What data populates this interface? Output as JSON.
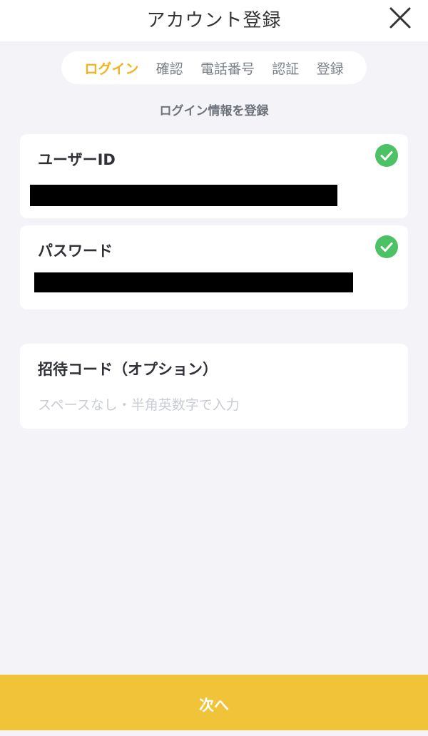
{
  "header": {
    "title": "アカウント登録",
    "close_icon": "close-icon"
  },
  "stepper": {
    "steps": [
      {
        "label": "ログイン",
        "active": true
      },
      {
        "label": "確認",
        "active": false
      },
      {
        "label": "電話番号",
        "active": false
      },
      {
        "label": "認証",
        "active": false
      },
      {
        "label": "登録",
        "active": false
      }
    ]
  },
  "section_title": "ログイン情報を登録",
  "form": {
    "user_id": {
      "label": "ユーザーID",
      "value_redacted": true,
      "valid": true,
      "status_icon": "check-circle-icon"
    },
    "password": {
      "label": "パスワード",
      "value_redacted": true,
      "valid": true,
      "status_icon": "check-circle-icon"
    },
    "invite_code": {
      "label": "招待コード（オプション）",
      "value": "",
      "placeholder": "スペースなし・半角英数字で入力"
    }
  },
  "footer": {
    "next_label": "次へ"
  },
  "colors": {
    "accent": "#f0b51e",
    "button_bg": "#f0c338",
    "check_green": "#4cc265",
    "background": "#f3f3f8"
  }
}
